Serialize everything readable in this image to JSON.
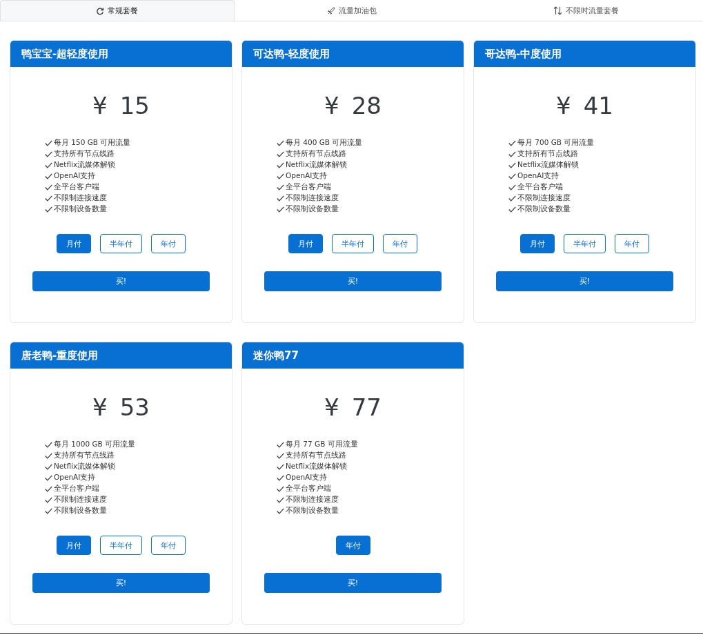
{
  "tabs": [
    {
      "label": "常规套餐",
      "kind": "regular",
      "selected": true
    },
    {
      "label": "流量加油包",
      "kind": "addon",
      "selected": false
    },
    {
      "label": "不限时流量套餐",
      "kind": "unlimited",
      "selected": false
    }
  ],
  "plans": [
    {
      "title": "鸭宝宝-超轻度使用",
      "currency": "¥",
      "price": "15",
      "features": [
        "每月 150 GB 可用流量",
        "支持所有节点线路",
        "Netflix流媒体解锁",
        "OpenAI支持",
        "全平台客户端",
        "不限制连接速度",
        "不限制设备数量"
      ],
      "periods": [
        {
          "label": "月付",
          "selected": true
        },
        {
          "label": "半年付",
          "selected": false
        },
        {
          "label": "年付",
          "selected": false
        }
      ],
      "buy": "买!"
    },
    {
      "title": "可达鸭-轻度使用",
      "currency": "¥",
      "price": "28",
      "features": [
        "每月 400 GB 可用流量",
        "支持所有节点线路",
        "Netflix流媒体解锁",
        "OpenAI支持",
        "全平台客户端",
        "不限制连接速度",
        "不限制设备数量"
      ],
      "periods": [
        {
          "label": "月付",
          "selected": true
        },
        {
          "label": "半年付",
          "selected": false
        },
        {
          "label": "年付",
          "selected": false
        }
      ],
      "buy": "买!"
    },
    {
      "title": "哥达鸭-中度使用",
      "currency": "¥",
      "price": "41",
      "features": [
        "每月 700 GB 可用流量",
        "支持所有节点线路",
        "Netflix流媒体解锁",
        "OpenAI支持",
        "全平台客户端",
        "不限制连接速度",
        "不限制设备数量"
      ],
      "periods": [
        {
          "label": "月付",
          "selected": true
        },
        {
          "label": "半年付",
          "selected": false
        },
        {
          "label": "年付",
          "selected": false
        }
      ],
      "buy": "买!"
    },
    {
      "title": "唐老鸭-重度使用",
      "currency": "¥",
      "price": "53",
      "features": [
        "每月 1000 GB 可用流量",
        "支持所有节点线路",
        "Netflix流媒体解锁",
        "OpenAI支持",
        "全平台客户端",
        "不限制连接速度",
        "不限制设备数量"
      ],
      "periods": [
        {
          "label": "月付",
          "selected": true
        },
        {
          "label": "半年付",
          "selected": false
        },
        {
          "label": "年付",
          "selected": false
        }
      ],
      "buy": "买!"
    },
    {
      "title": "迷你鸭77",
      "currency": "¥",
      "price": "77",
      "features": [
        "每月 77 GB 可用流量",
        "支持所有节点线路",
        "Netflix流媒体解锁",
        "OpenAI支持",
        "全平台客户端",
        "不限制连接速度",
        "不限制设备数量"
      ],
      "periods": [
        {
          "label": "年付",
          "selected": true
        }
      ],
      "buy": "买!"
    }
  ]
}
